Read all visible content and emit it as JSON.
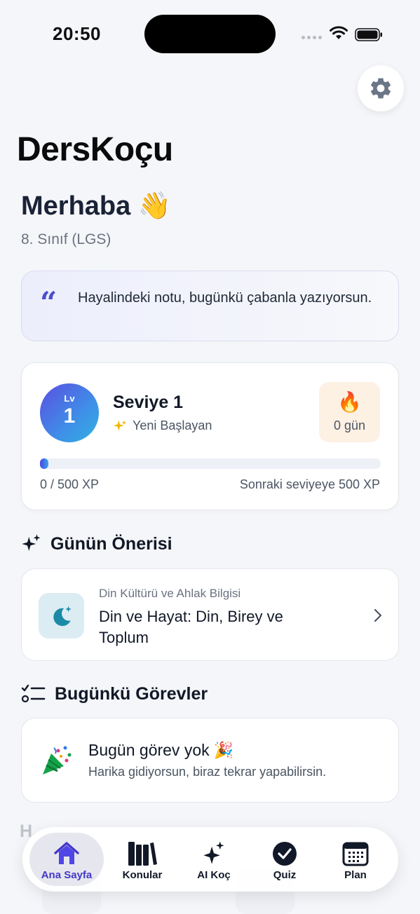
{
  "status_bar": {
    "time": "20:50"
  },
  "app": {
    "title": "DersKoçu"
  },
  "header": {
    "greeting": "Merhaba",
    "greeting_emoji": "👋",
    "grade": "8. Sınıf (LGS)"
  },
  "quote": {
    "text": "Hayalindeki notu, bugünkü çabanla yazıyorsun."
  },
  "level": {
    "badge_small": "Lv",
    "badge_number": "1",
    "title": "Seviye 1",
    "subtitle": "Yeni Başlayan",
    "streak_emoji": "🔥",
    "streak": "0 gün",
    "xp_current": "0 / 500 XP",
    "xp_next": "Sonraki seviyeye 500 XP",
    "xp_progress_fraction": 0
  },
  "suggestion": {
    "section_title": "Günün Önerisi",
    "category": "Din Kültürü ve Ahlak Bilgisi",
    "title": "Din ve Hayat: Din, Birey ve Toplum"
  },
  "tasks": {
    "section_title": "Bugünkü Görevler",
    "empty_title": "Bugün görev yok",
    "empty_emoji": "🎉",
    "empty_subtitle": "Harika gidiyorsun, biraz tekrar yapabilirsin."
  },
  "tab_bar": {
    "items": [
      {
        "label": "Ana Sayfa",
        "icon": "home-icon",
        "active": true
      },
      {
        "label": "Konular",
        "icon": "books-icon",
        "active": false
      },
      {
        "label": "AI Koç",
        "icon": "sparkles-icon",
        "active": false
      },
      {
        "label": "Quiz",
        "icon": "check-circle-icon",
        "active": false
      },
      {
        "label": "Plan",
        "icon": "calendar-icon",
        "active": false
      }
    ]
  },
  "colors": {
    "accent": "#4338ca",
    "background": "#f5f6f9",
    "streak_bg": "#fdf1e4"
  }
}
